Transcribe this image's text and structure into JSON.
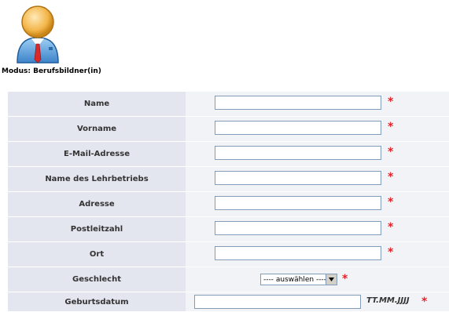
{
  "header": {
    "mode_label": "Modus: Berufsbildner(in)"
  },
  "form": {
    "fields": [
      {
        "label": "Name",
        "value": "",
        "required": "*"
      },
      {
        "label": "Vorname",
        "value": "",
        "required": "*"
      },
      {
        "label": "E-Mail-Adresse",
        "value": "",
        "required": "*"
      },
      {
        "label": "Name des Lehrbetriebs",
        "value": "",
        "required": "*"
      },
      {
        "label": "Adresse",
        "value": "",
        "required": "*"
      },
      {
        "label": "Postleitzahl",
        "value": "",
        "required": "*"
      },
      {
        "label": "Ort",
        "value": "",
        "required": "*"
      }
    ],
    "gender": {
      "label": "Geschlecht",
      "selected": "---- auswählen ----",
      "required": "*"
    },
    "birthdate": {
      "label": "Geburtsdatum",
      "value": "",
      "hint": "TT.MM.JJJJ",
      "required": "*"
    }
  },
  "colors": {
    "label_bg": "#e3e6ee",
    "value_bg": "#f2f3f7",
    "required": "#e8222b"
  },
  "icons": {
    "avatar": "user-avatar-icon",
    "dropdown": "dropdown-arrow-icon"
  }
}
